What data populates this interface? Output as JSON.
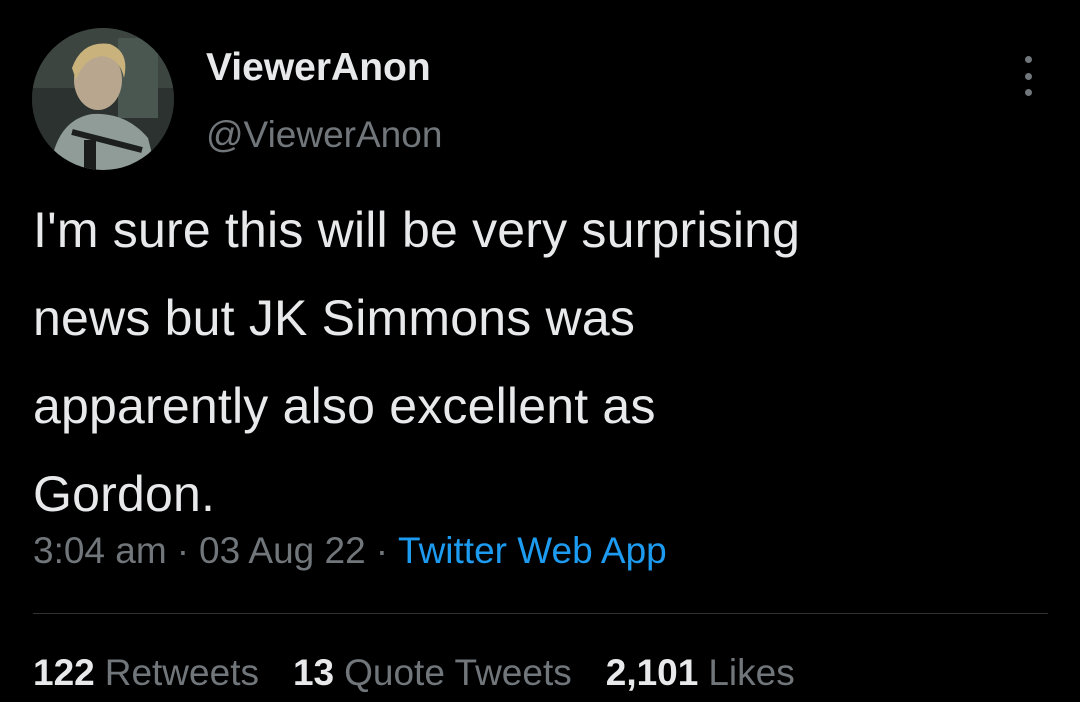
{
  "user": {
    "display_name": "ViewerAnon",
    "handle": "@ViewerAnon",
    "avatar_icon": "user-avatar-photo"
  },
  "tweet": {
    "lines": [
      "I'm sure this will be very surprising",
      "news but JK Simmons was",
      "apparently also excellent as",
      "Gordon."
    ]
  },
  "meta": {
    "time": "3:04 am",
    "separator": "·",
    "date": "03 Aug 22",
    "source": "Twitter Web App"
  },
  "stats": {
    "retweets_count": "122",
    "retweets_label": "Retweets",
    "quotes_count": "13",
    "quotes_label": "Quote Tweets",
    "likes_count": "2,101",
    "likes_label": "Likes"
  },
  "colors": {
    "background": "#000000",
    "text": "#e7e9ea",
    "secondary": "#71767b",
    "link": "#1d9bf0"
  }
}
